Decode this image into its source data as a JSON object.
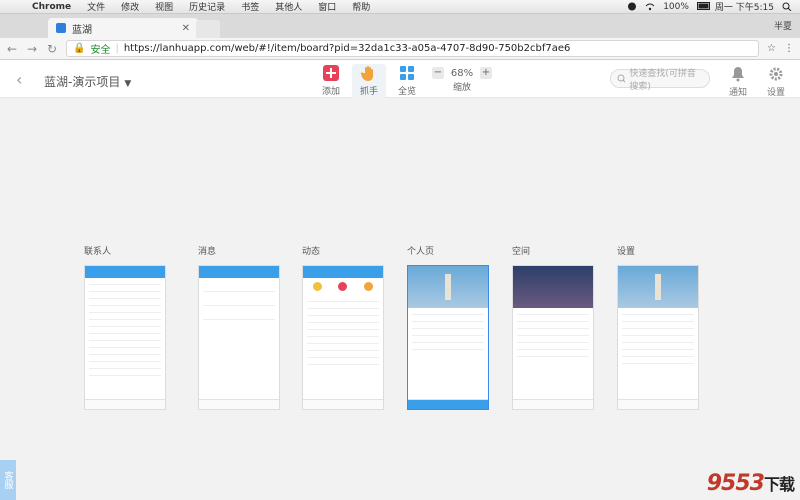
{
  "menubar": {
    "app_name": "Chrome",
    "items": [
      "文件",
      "修改",
      "视图",
      "历史记录",
      "书签",
      "其他人",
      "窗口",
      "帮助"
    ],
    "battery": "100%",
    "clock": "周一 下午5:15"
  },
  "browser": {
    "tab_title": "蓝湖",
    "profile_name": "半夏",
    "secure_label": "安全",
    "url": "https://lanhuapp.com/web/#!/item/board?pid=32da1c33-a05a-4707-8d90-750b2cbf7ae6"
  },
  "header": {
    "project_title": "蓝湖-演示项目",
    "tools": {
      "add": "添加",
      "grab": "抓手",
      "overview": "全览",
      "zoom_label": "缩放",
      "zoom_value": "68%",
      "zoom_minus": "−",
      "zoom_plus": "+"
    },
    "search_placeholder": "快速查找(可拼音搜索)",
    "notify": "通知",
    "settings": "设置"
  },
  "boards": [
    {
      "label": "联系人"
    },
    {
      "label": "消息"
    },
    {
      "label": "动态"
    },
    {
      "label": "个人页"
    },
    {
      "label": "空间"
    },
    {
      "label": "设置"
    }
  ],
  "kefu": "客服",
  "watermark": {
    "brand": "9553",
    "suffix": "下载"
  },
  "colors": {
    "accent": "#3a9fe8",
    "add_red": "#e8415a",
    "grab_orange": "#f2a33a"
  }
}
